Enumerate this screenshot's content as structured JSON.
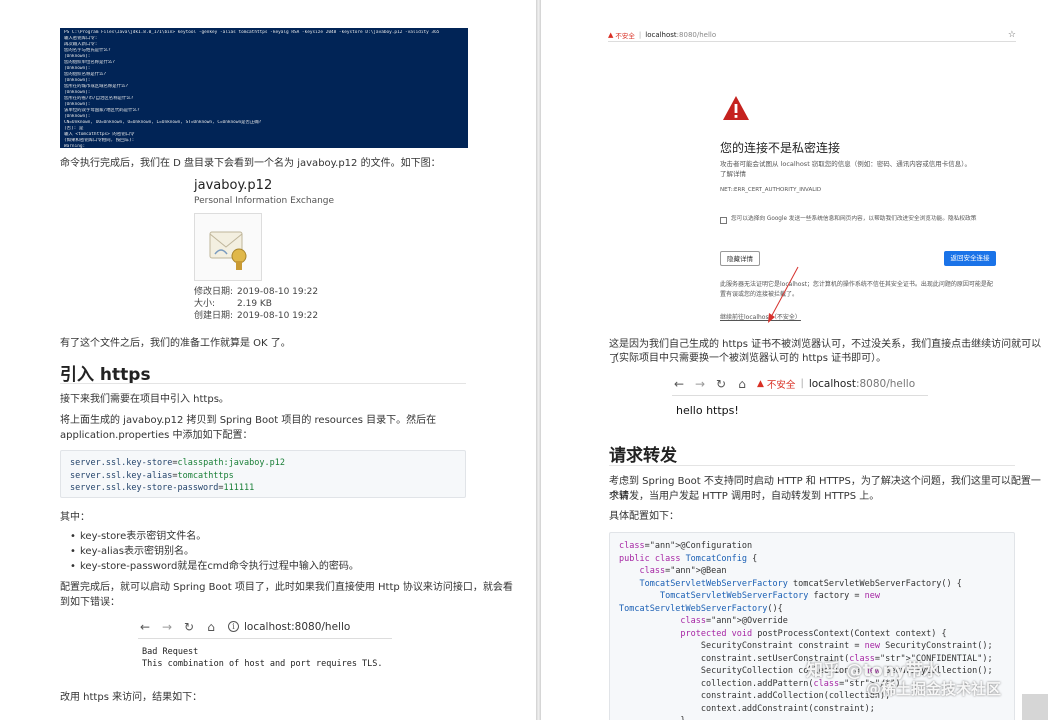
{
  "left": {
    "terminal_lines": [
      "PS C:\\Program Files\\Java\\jdk1.8.0_171\\bin> keytool -genkey -alias tomcathttps -keyalg RSA -keysize 2048 -keystore D:\\javaboy.p12 -validity 365",
      "输入密钥库口令:",
      "再次输入新口令:",
      "您的名字与姓氏是什么?",
      "  [Unknown]:",
      "您的组织单位名称是什么?",
      "  [Unknown]:",
      "您的组织名称是什么?",
      "  [Unknown]:",
      "您所在的城市或区域名称是什么?",
      "  [Unknown]:",
      "您所在的省/市/自治区名称是什么?",
      "  [Unknown]:",
      "该单位的双字母国家/地区代码是什么?",
      "  [Unknown]:",
      "CN=Unknown, OU=Unknown, O=Unknown, L=Unknown, ST=Unknown, C=Unknown是否正确?",
      "  [否]:  是",
      "",
      "输入 <tomcathttps> 的密钥口令",
      "        (如果和密钥库口令相同, 按回车):",
      "",
      "Warning:",
      "JKS 密钥库使用专用格式。建议使用 \"keytool -importkeystore -srckeystore D:\\javaboy.p12 -destkeystore D:\\javaboy.p12 -deststoretype pkcs12\" 迁移到行业标准格式 PKCS12。",
      "PS C:\\Program Files\\Java\\jdk1.8.0_171\\bin>"
    ],
    "para1": "命令执行完成后，我们在 D 盘目录下会看到一个名为 javaboy.p12 的文件。如下图：",
    "file": {
      "name": "javaboy.p12",
      "type": "Personal Information Exchange",
      "props": [
        {
          "k": "修改日期:",
          "v": "2019-08-10 19:22"
        },
        {
          "k": "大小:",
          "v": "2.19 KB"
        },
        {
          "k": "创建日期:",
          "v": "2019-08-10 19:22"
        }
      ]
    },
    "para2": "有了这个文件之后，我们的准备工作就算是 OK 了。",
    "heading": "引入 https",
    "para3": "接下来我们需要在项目中引入 https。",
    "para4a": "将上面生成的 javaboy.p12 拷贝到 Spring Boot 项目的 resources 目录下。然后在",
    "para4b": "application.properties 中添加如下配置：",
    "props_code": [
      {
        "key": "server.ssl.key-store",
        "val": "classpath:javaboy.p12"
      },
      {
        "key": "server.ssl.key-alias",
        "val": "tomcathttps"
      },
      {
        "key": "server.ssl.key-store-password",
        "val": "111111"
      }
    ],
    "para5": "其中：",
    "bullets": [
      "key-store表示密钥文件名。",
      "key-alias表示密钥别名。",
      "key-store-password就是在cmd命令执行过程中输入的密码。"
    ],
    "para6a": "配置完成后，就可以启动 Spring Boot 项目了，此时如果我们直接使用 Http 协议来访问接口，就会看",
    "para6b": "到如下错误：",
    "browser1_url": "localhost:8080/hello",
    "bad_request": "Bad Request\nThis combination of host and port requires TLS.",
    "para7": "改用 https 来访问，结果如下："
  },
  "right": {
    "warn": {
      "insecure": "不安全",
      "url_host": "localhost",
      "url_rest": ":8080/hello",
      "title": "您的连接不是私密连接",
      "desc": "攻击者可能会试图从 localhost 窃取您的信息（例如：密码、通讯内容或信用卡信息）。了解详情",
      "code": "NET::ERR_CERT_AUTHORITY_INVALID",
      "checkbox_text": "您可以选择向 Google 发送一些系统信息和网页内容，以帮助我们改进安全浏览功能。隐私权政策",
      "hide_btn": "隐藏详情",
      "back_btn": "返回安全连接",
      "detail": "此服务器无法证明它是localhost；您计算机的操作系统不信任其安全证书。出现此问题的原因可能是配置有误或您的连接被拦截了。",
      "proceed": "继续前往localhost（不安全）"
    },
    "para1a": "这是因为我们自己生成的 https 证书不被浏览器认可，不过没关系，我们直接点击继续访问就可以了",
    "para1b": "（实际项目中只需要换一个被浏览器认可的 https 证书即可）。",
    "browser2": {
      "insecure": "不安全",
      "url_host": "localhost",
      "url_rest": ":8080/hello",
      "body": "hello https!"
    },
    "heading": "请求转发",
    "para2a": "考虑到 Spring Boot 不支持同时启动 HTTP 和 HTTPS，为了解决这个问题，我们这里可以配置一个请",
    "para2b": "求转发，当用户发起 HTTP 调用时，自动转发到 HTTPS 上。",
    "para3": "具体配置如下：",
    "java": [
      "@Configuration",
      "public class TomcatConfig {",
      "    @Bean",
      "    TomcatServletWebServerFactory tomcatServletWebServerFactory() {",
      "        TomcatServletWebServerFactory factory = new",
      "TomcatServletWebServerFactory(){",
      "            @Override",
      "            protected void postProcessContext(Context context) {",
      "                SecurityConstraint constraint = new SecurityConstraint();",
      "                constraint.setUserConstraint(\"CONFIDENTIAL\");",
      "                SecurityCollection collection = new SecurityCollection();",
      "                collection.addPattern(\"/*\");",
      "                constraint.addCollection(collection);",
      "                context.addConstraint(constraint);",
      "            }"
    ],
    "watermark1": "知乎 @tony带水",
    "watermark2": "@稀土掘金技术社区"
  }
}
